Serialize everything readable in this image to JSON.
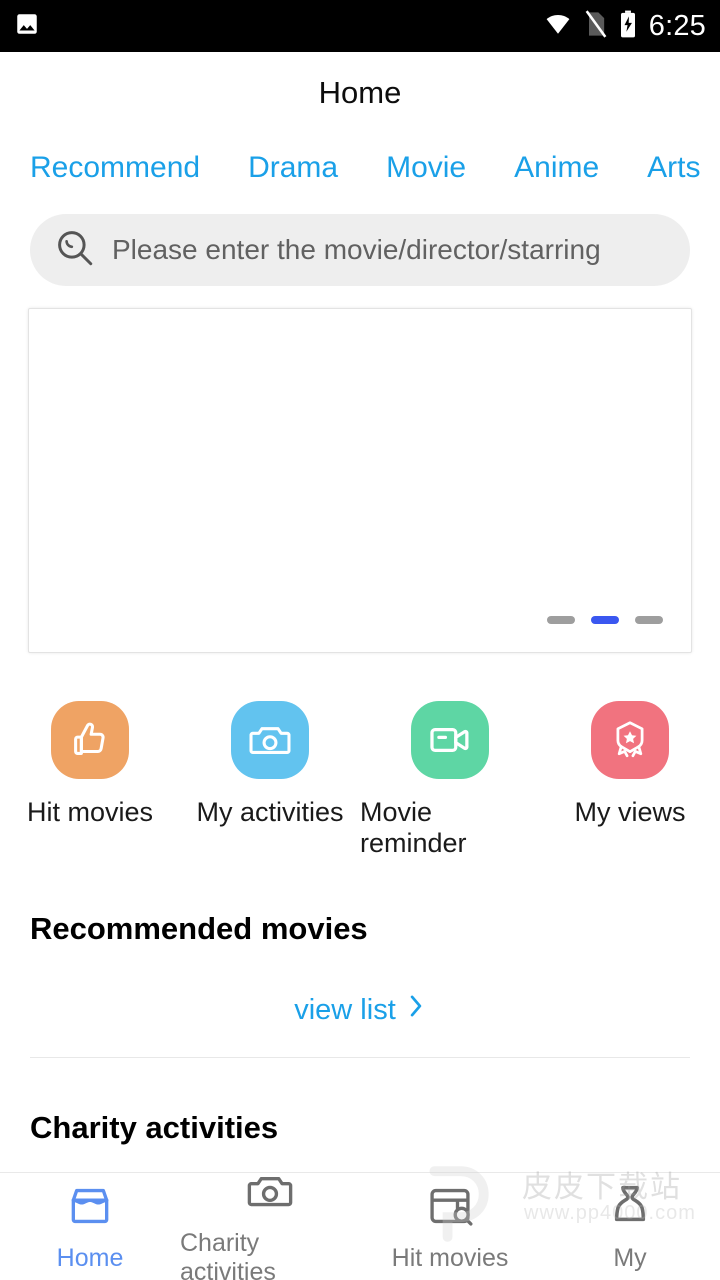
{
  "status_bar": {
    "time": "6:25",
    "icons": [
      "image-icon",
      "wifi-icon",
      "no-sim-icon",
      "battery-charging-icon"
    ]
  },
  "header": {
    "title": "Home"
  },
  "tabs": [
    {
      "label": "Recommend",
      "active": true
    },
    {
      "label": "Drama",
      "active": false
    },
    {
      "label": "Movie",
      "active": false
    },
    {
      "label": "Anime",
      "active": false
    },
    {
      "label": "Arts",
      "active": false
    }
  ],
  "search": {
    "placeholder": "Please enter the movie/director/starring",
    "value": "",
    "icon": "search-icon"
  },
  "banner": {
    "slides_total": 3,
    "active_index": 2,
    "active_color": "#3a57f0",
    "inactive_color": "#9e9e9e"
  },
  "quick_actions": [
    {
      "label": "Hit movies",
      "icon": "thumbs-up-icon",
      "color": "#efa364"
    },
    {
      "label": "My activities",
      "icon": "camera-icon",
      "color": "#62c3ef"
    },
    {
      "label": "Movie reminder",
      "icon": "video-camera-icon",
      "color": "#5ed6a4"
    },
    {
      "label": "My views",
      "icon": "award-badge-icon",
      "color": "#f1737f"
    }
  ],
  "sections": {
    "recommended_title": "Recommended movies",
    "view_list_label": "view list",
    "view_list_icon": "chevron-right-icon",
    "charity_title": "Charity activities"
  },
  "bottom_nav": [
    {
      "label": "Home",
      "icon": "store-icon",
      "active": true
    },
    {
      "label": "Charity activities",
      "icon": "camera-icon",
      "active": false
    },
    {
      "label": "Hit movies",
      "icon": "window-search-icon",
      "active": false
    },
    {
      "label": "My",
      "icon": "person-icon",
      "active": false
    }
  ],
  "watermark": {
    "text": "皮皮下载站",
    "url": "www.pp4000.com",
    "logo": "pp-logo-icon"
  },
  "colors": {
    "accent_blue": "#1aa0e8",
    "nav_active": "#5b8ff0",
    "search_bg": "#eeeeee"
  }
}
